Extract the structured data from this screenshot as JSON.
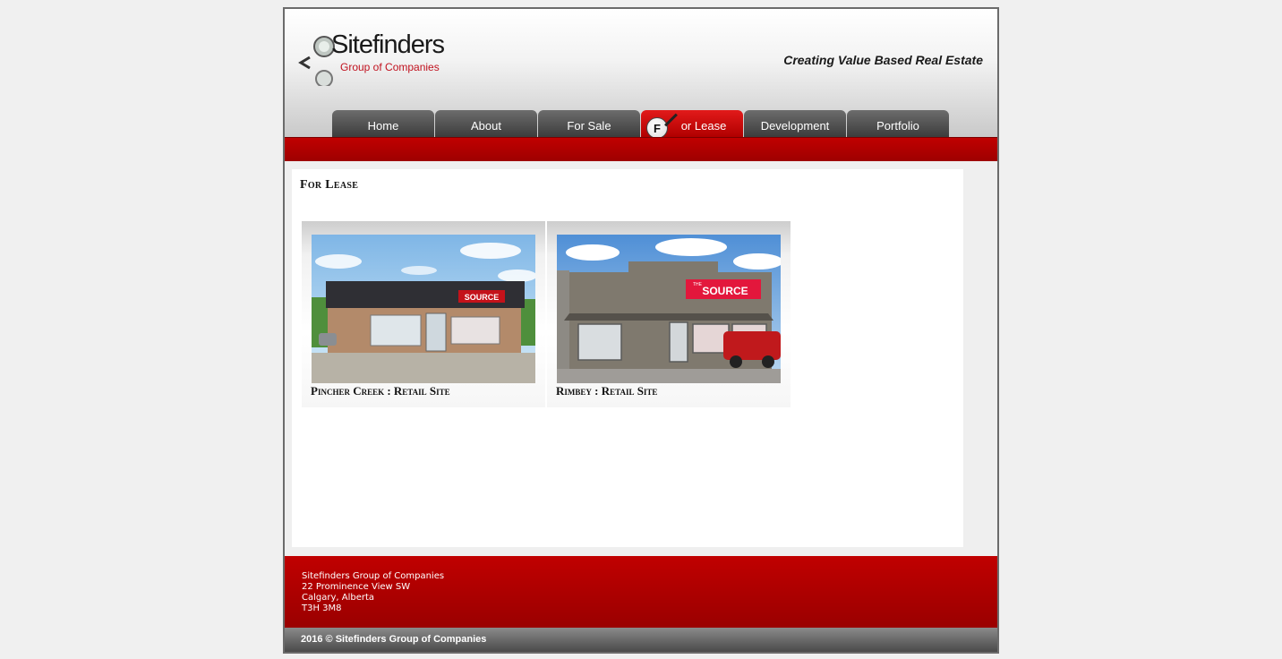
{
  "brand": {
    "name": "Sitefinders",
    "subtitle": "Group of Companies",
    "tagline": "Creating Value Based Real Estate"
  },
  "nav": {
    "items": [
      {
        "label": "Home"
      },
      {
        "label": "About"
      },
      {
        "label": "For Sale"
      },
      {
        "label": "or Lease",
        "badge": "F"
      },
      {
        "label": "Development"
      },
      {
        "label": "Portfolio"
      }
    ],
    "active_index": 3
  },
  "page": {
    "title": "For Lease"
  },
  "listings": [
    {
      "caption": "Pincher Creek : Retail Site",
      "sign_text": "SOURCE"
    },
    {
      "caption": "Rimbey : Retail Site",
      "sign_text": "SOURCE",
      "sign_small": "THE"
    }
  ],
  "footer": {
    "address_lines": [
      "Sitefinders Group of Companies",
      "22 Prominence View SW",
      "Calgary, Alberta",
      "T3H 3M8"
    ],
    "copyright": "2016 © Sitefinders Group of Companies"
  },
  "colors": {
    "brand_red": "#b00000",
    "nav_gray": "#4f4f4f",
    "accent_red": "#c1121f"
  },
  "icons": {
    "logo": "magnifier-icon"
  }
}
